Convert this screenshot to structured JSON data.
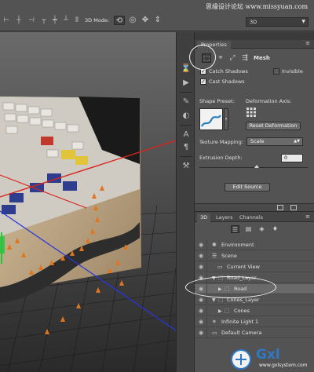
{
  "watermark": "思缘设计论坛 www.missyuan.com",
  "options_bar": {
    "mode_label": "3D Mode:",
    "workspace": "3D",
    "icons": [
      "align-left-icon",
      "align-center-icon",
      "align-right-icon",
      "align-top-icon",
      "align-middle-icon",
      "align-bottom-icon",
      "distribute-icon",
      "distribute-icon",
      "distribute-icon",
      "distribute-icon",
      "distribute-icon"
    ],
    "mode_icons": [
      "rotate-3d-icon",
      "roll-3d-icon",
      "drag-3d-icon",
      "slide-3d-icon",
      "scale-3d-icon"
    ]
  },
  "properties": {
    "tab_label": "Properties",
    "tool_icons": [
      "mesh-icon",
      "deform-icon",
      "cap-icon",
      "coordinates-icon"
    ],
    "section_label": "Mesh",
    "catch_shadows": {
      "label": "Catch Shadows",
      "checked": true
    },
    "invisible": {
      "label": "Invisible",
      "checked": false
    },
    "cast_shadows": {
      "label": "Cast Shadows",
      "checked": true
    },
    "shape_preset_label": "Shape Preset:",
    "deformation_axis_label": "Deformation Axis:",
    "reset_deformation": "Reset Deformation",
    "texture_mapping_label": "Texture Mapping:",
    "texture_mapping_value": "Scale",
    "extrusion_depth_label": "Extrusion Depth:",
    "extrusion_depth_value": "0",
    "edit_source": "Edit Source"
  },
  "panel_3d": {
    "tabs": [
      "3D",
      "Layers",
      "Channels"
    ],
    "filter_icons": [
      "whole-scene-icon",
      "meshes-icon",
      "materials-icon",
      "lights-icon"
    ],
    "rows": [
      {
        "label": "Environment"
      },
      {
        "label": "Scene"
      },
      {
        "label": "Current View"
      },
      {
        "label": "Road_Layer"
      },
      {
        "label": "Road"
      },
      {
        "label": "Cones_Layer"
      },
      {
        "label": "Cones"
      },
      {
        "label": "Infinite Light 1"
      },
      {
        "label": "Default Camera"
      }
    ]
  },
  "logo": {
    "text": "Gxl",
    "sub": "www.gxlsystem.com"
  }
}
